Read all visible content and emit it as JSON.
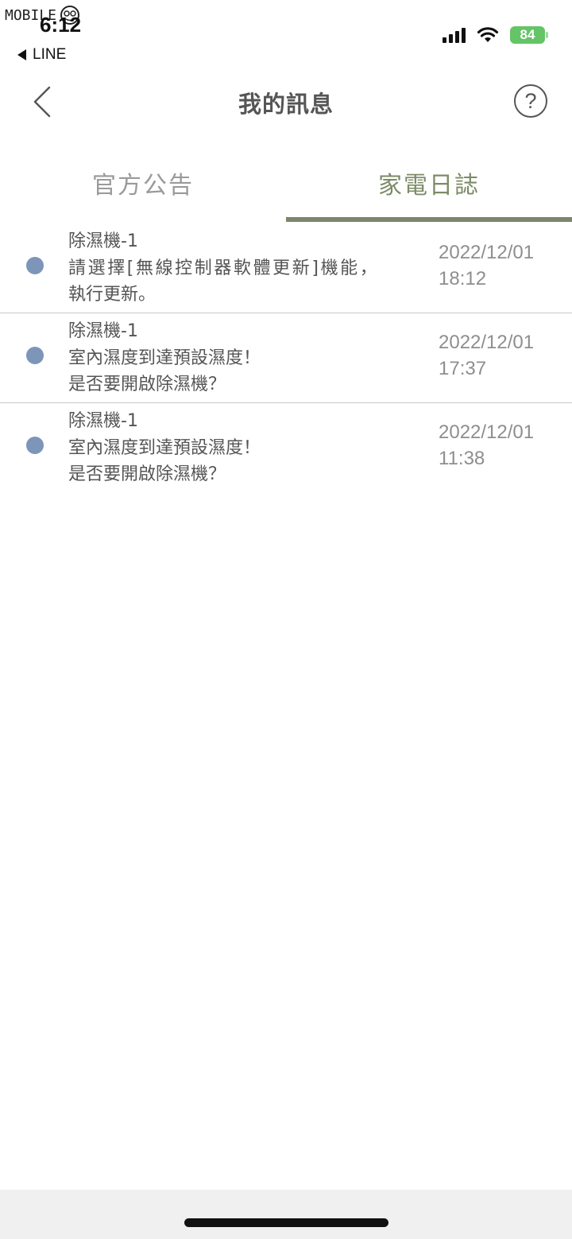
{
  "watermark": {
    "text": "MOBILE"
  },
  "status_bar": {
    "time": "6:12",
    "back_app_label": "LINE",
    "battery_level": "84",
    "icons": [
      "cellular-signal-icon",
      "wifi-icon",
      "battery-charging-icon"
    ]
  },
  "nav": {
    "title": "我的訊息",
    "back_icon": "chevron-left-icon",
    "help_label": "?"
  },
  "tabs": [
    {
      "label": "官方公告",
      "active": false
    },
    {
      "label": "家電日誌",
      "active": true
    }
  ],
  "colors": {
    "active_tab_text": "#7b8c66",
    "active_tab_underline": "#7a8768",
    "unread_dot": "#7d95b8",
    "battery": "#65c466"
  },
  "messages": [
    {
      "device": "除濕機-1",
      "lines": [
        "請選擇[無線控制器軟體更新]機能，",
        "執行更新。"
      ],
      "date": "2022/12/01",
      "time": "18:12"
    },
    {
      "device": "除濕機-1",
      "lines": [
        "室內濕度到達預設濕度！",
        "是否要開啟除濕機？"
      ],
      "date": "2022/12/01",
      "time": "17:37"
    },
    {
      "device": "除濕機-1",
      "lines": [
        "室內濕度到達預設濕度！",
        "是否要開啟除濕機？"
      ],
      "date": "2022/12/01",
      "time": "11:38"
    }
  ]
}
